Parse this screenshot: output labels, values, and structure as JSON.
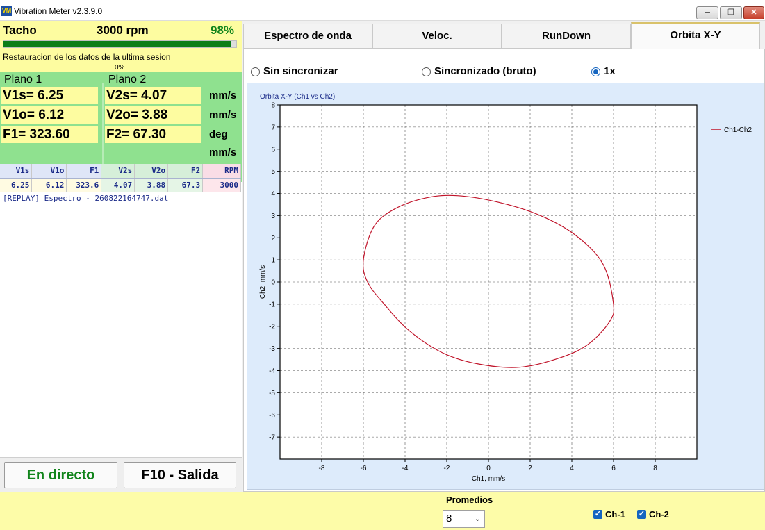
{
  "window": {
    "title": "Vibration Meter v2.3.9.0",
    "icon": "VM",
    "controls": [
      "minimize-icon",
      "restore-icon",
      "close-icon"
    ]
  },
  "tacho": {
    "label": "Tacho",
    "rpm": "3000 rpm",
    "percent": "98%",
    "bar_fill": 0.98
  },
  "restore": {
    "text": "Restauracion de los datos de la ultima sesion",
    "percent": "0%"
  },
  "planes": {
    "plane1": {
      "title": "Plano 1",
      "v1s": "V1s= 6.25",
      "v1o": "V1o= 6.12",
      "f1": "F1= 323.60"
    },
    "plane2": {
      "title": "Plano 2",
      "v2s": "V2s= 4.07",
      "v2o": "V2o= 3.88",
      "f2": "F2= 67.30"
    },
    "units": [
      "mm/s",
      "mm/s",
      "deg",
      "mm/s"
    ]
  },
  "table": {
    "headers": [
      "V1s",
      "V1o",
      "F1",
      "V2s",
      "V2o",
      "F2",
      "RPM"
    ],
    "rows": [
      [
        "6.25",
        "6.12",
        "323.6",
        "4.07",
        "3.88",
        "67.3",
        "3000"
      ]
    ]
  },
  "replay": "[REPLAY] Espectro - 260822164747.dat",
  "buttons": {
    "live": "En directo",
    "exit": "F10 - Salida"
  },
  "tabs": [
    "Espectro de onda",
    "Veloc.",
    "RunDown",
    "Orbita X-Y"
  ],
  "active_tab": "Orbita X-Y",
  "sync": {
    "options": [
      "Sin sincronizar",
      "Sincronizado (bruto)",
      "1x"
    ],
    "selected": "1x"
  },
  "promedios": {
    "label": "Promedios",
    "value": "8"
  },
  "channels": [
    {
      "label": "Ch-1",
      "checked": true
    },
    {
      "label": "Ch-2",
      "checked": true
    }
  ],
  "colors": {
    "accent": "#1565c0",
    "trace": "#c0142a",
    "good": "#11841b",
    "panel_green": "#8fe18f",
    "panel_yellow": "#fdfca0"
  },
  "chart_data": {
    "type": "line",
    "title": "Orbita X-Y (Ch1 vs Ch2)",
    "xlabel": "Ch1, mm/s",
    "ylabel": "Ch2, mm/s",
    "xlim": [
      -10,
      10
    ],
    "ylim": [
      -8,
      8
    ],
    "xticks": [
      -8,
      -6,
      -4,
      -2,
      0,
      2,
      4,
      6,
      8
    ],
    "yticks": [
      8,
      7,
      6,
      5,
      4,
      3,
      2,
      1,
      0,
      -1,
      -2,
      -3,
      -4,
      -5,
      -6,
      -7
    ],
    "grid": true,
    "legend": "top-right",
    "series": [
      {
        "name": "Ch1-Ch2",
        "x": [
          -6.0,
          -5.5,
          -4.5,
          -3.0,
          -1.5,
          0.5,
          2.5,
          4.2,
          5.5,
          6.0,
          5.8,
          4.8,
          3.5,
          1.5,
          -0.5,
          -2.2,
          -3.8,
          -5.0,
          -5.8,
          -6.0
        ],
        "y": [
          1.0,
          2.5,
          3.3,
          3.8,
          3.9,
          3.6,
          3.0,
          2.1,
          0.8,
          -1.0,
          -1.8,
          -2.8,
          -3.4,
          -3.85,
          -3.7,
          -3.2,
          -2.2,
          -1.0,
          0.0,
          1.0
        ]
      }
    ]
  }
}
